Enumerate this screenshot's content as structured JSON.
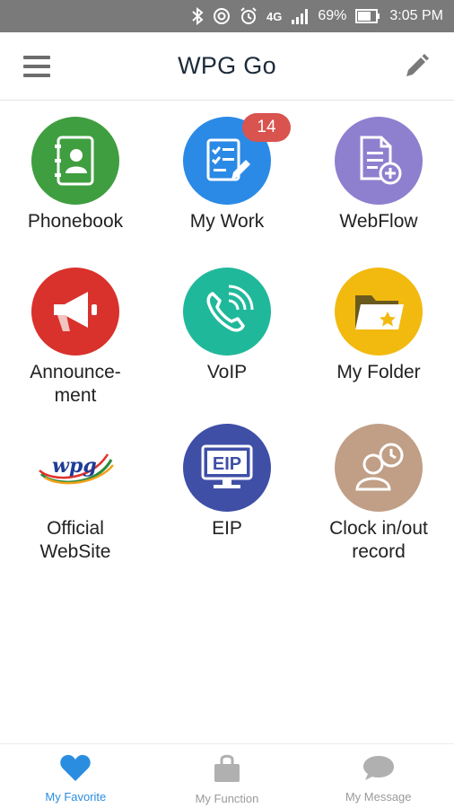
{
  "status_bar": {
    "battery": "69%",
    "time": "3:05 PM",
    "network": "4G",
    "icons": [
      "bluetooth-icon",
      "nfc-icon",
      "alarm-icon",
      "network-4g-icon",
      "signal-icon",
      "battery-icon"
    ]
  },
  "header": {
    "title": "WPG Go",
    "menu_icon": "hamburger-menu-icon",
    "edit_icon": "pencil-icon"
  },
  "tiles": [
    {
      "label": "Phonebook",
      "icon": "phonebook-icon",
      "color": "#3f9e3f"
    },
    {
      "label": "My Work",
      "icon": "task-checklist-icon",
      "color": "#2b8ae6",
      "badge": "14"
    },
    {
      "label": "WebFlow",
      "icon": "document-add-icon",
      "color": "#8f7fcf"
    },
    {
      "label": "Announce-\nment",
      "icon": "megaphone-icon",
      "color": "#d9312b"
    },
    {
      "label": "VoIP",
      "icon": "phone-call-icon",
      "color": "#20b89b"
    },
    {
      "label": "My Folder",
      "icon": "folder-star-icon",
      "color": "#f2b90f"
    },
    {
      "label": "Official\nWebSite",
      "icon": "wpg-logo",
      "color": "#ffffff"
    },
    {
      "label": "EIP",
      "icon": "monitor-eip-icon",
      "color": "#3f4fa6",
      "screen_text": "EIP"
    },
    {
      "label": "Clock in/out\nrecord",
      "icon": "user-clock-icon",
      "color": "#c09f86"
    }
  ],
  "logo_text": "wpg",
  "bottom_nav": [
    {
      "label": "My Favorite",
      "icon": "heart-icon",
      "active": true
    },
    {
      "label": "My Function",
      "icon": "shopping-bag-icon",
      "active": false
    },
    {
      "label": "My Message",
      "icon": "chat-bubble-icon",
      "active": false
    }
  ],
  "colors": {
    "accent": "#2a8de0",
    "badge": "#d9534f",
    "status_bar": "#7a7a7a",
    "inactive": "#9a9a9a"
  }
}
